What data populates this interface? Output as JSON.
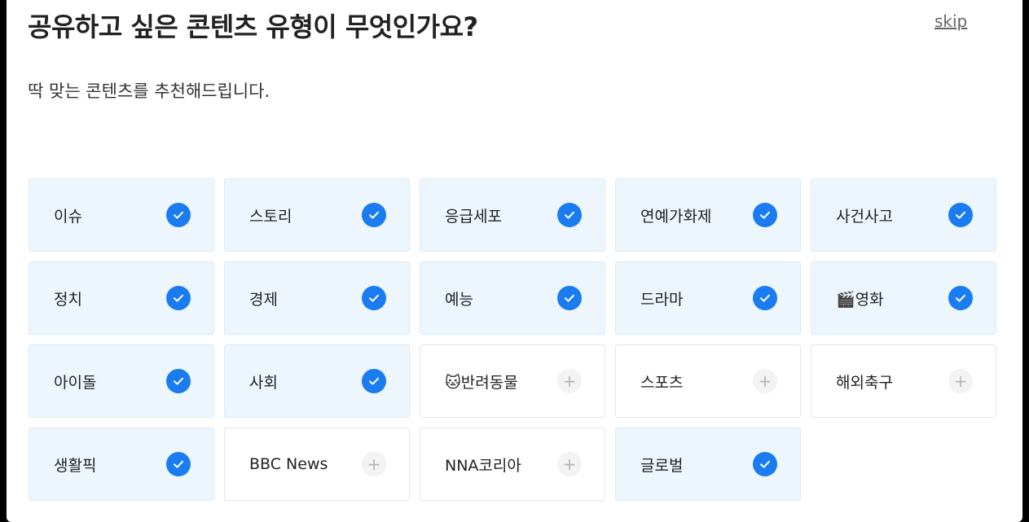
{
  "header": {
    "title": "공유하고 싶은 콘텐츠 유형이 무엇인가요?",
    "subtitle": "딱 맞는 콘텐츠를 추천해드립니다.",
    "skip_label": "skip"
  },
  "colors": {
    "accent": "#1a7cf0",
    "selected_bg": "#eef6fd"
  },
  "categories": [
    {
      "label": "이슈",
      "selected": true
    },
    {
      "label": "스토리",
      "selected": true
    },
    {
      "label": "응급세포",
      "selected": true
    },
    {
      "label": "연예가화제",
      "selected": true
    },
    {
      "label": "사건사고",
      "selected": true
    },
    {
      "label": "정치",
      "selected": true
    },
    {
      "label": "경제",
      "selected": true
    },
    {
      "label": "예능",
      "selected": true
    },
    {
      "label": "드라마",
      "selected": true
    },
    {
      "label": "🎬영화",
      "selected": true
    },
    {
      "label": "아이돌",
      "selected": true
    },
    {
      "label": "사회",
      "selected": true
    },
    {
      "label": "🐱반려동물",
      "selected": false
    },
    {
      "label": "스포츠",
      "selected": false
    },
    {
      "label": "해외축구",
      "selected": false
    },
    {
      "label": "생활픽",
      "selected": true
    },
    {
      "label": "BBC News",
      "selected": false
    },
    {
      "label": "NNA코리아",
      "selected": false
    },
    {
      "label": "글로벌",
      "selected": true
    }
  ]
}
